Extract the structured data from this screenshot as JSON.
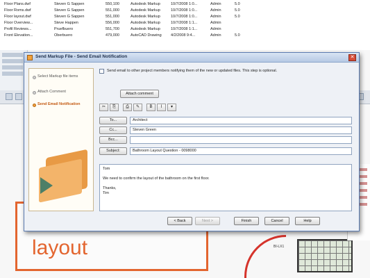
{
  "background": {
    "file_rows": [
      [
        "Floor Plans.dwf",
        "Steven G Sappen",
        "550,100",
        "Autodesk Markup",
        "10/7/2008 1:0...",
        "Admin",
        "5.0"
      ],
      [
        "Floor Roms.dwf",
        "Steven G Sappen",
        "551,000",
        "Autodesk Markup",
        "10/7/2008 1:0...",
        "Admin",
        "5.0"
      ],
      [
        "Floor layout.dwf",
        "Steven G Sappen",
        "551,000",
        "Autodesk Markup",
        "10/7/2008 1:0...",
        "Admin",
        "5.0"
      ],
      [
        "Floor Overview...",
        "Steve Happen",
        "556,000",
        "Autodesk Markup",
        "10/7/2008 1:1...",
        "Admin",
        ""
      ],
      [
        "Profil Reviews...",
        "Pruefbuero",
        "551,700",
        "Autodesk Markup",
        "10/7/2008 1:1...",
        "Admin",
        ""
      ],
      [
        "Front Elevation...",
        "Oberbuero",
        "479,000",
        "AutoCAD Drawing",
        "4/2/2008 9:4...",
        "Admin",
        "5.0"
      ]
    ],
    "highlight_word": "layout",
    "small_label": "BI-LX1"
  },
  "dialog": {
    "title": "Send Markup File - Send Email Notification",
    "close_glyph": "✕",
    "steps": [
      {
        "label": "Select Markup file items",
        "active": false
      },
      {
        "label": "Attach Comment",
        "active": false
      },
      {
        "label": "Send Email Notification",
        "active": true
      }
    ],
    "send_option_label": "Send email to other project members notifying them of the new or updated files. This step is optional.",
    "attach_button": "Attach comment",
    "format_buttons": [
      "✂",
      "⎘",
      "⎙",
      "✎",
      "B",
      "I",
      "▾"
    ],
    "to_button": "To...",
    "to_value": "Architect",
    "cc_button": "Cc...",
    "cc_value": "Steven Green",
    "bcc_button": "Bcc...",
    "bcc_value": "",
    "subject_label": "Subject:",
    "subject_value": "Bathroom Layout Question - 0098000",
    "body_text": "Tom\n\nWe need to confirm the layout of the bathroom on the first floor.\n\nThanks,\nTim",
    "buttons": {
      "back": "< Back",
      "next": "Next >",
      "finish": "Finish",
      "cancel": "Cancel",
      "help": "Help"
    }
  }
}
